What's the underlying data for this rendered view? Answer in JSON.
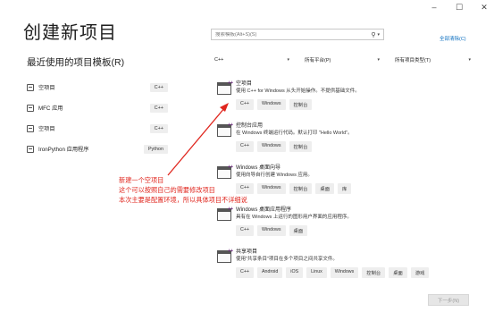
{
  "window": {
    "minimize": "–",
    "maximize": "☐",
    "close": "✕"
  },
  "page_title": "创建新项目",
  "recent": {
    "title": "最近使用的项目模板(R)",
    "items": [
      {
        "name": "空项目",
        "lang": "C++"
      },
      {
        "name": "MFC 应用",
        "lang": "C++"
      },
      {
        "name": "空项目",
        "lang": "C++"
      },
      {
        "name": "IronPython 应用程序",
        "lang": "Python"
      }
    ]
  },
  "search": {
    "placeholder": "搜索模板(Alt+S)(S)",
    "icon": "search-icon"
  },
  "clear_all": "全部清除(C)",
  "filters": {
    "language": "C++",
    "platform": "所有平台(P)",
    "project_type": "所有项目类型(T)"
  },
  "templates": [
    {
      "name": "空项目",
      "desc": "使用 C++ for Windows 从头开始操作。不提供基础文件。",
      "tags": [
        "C++",
        "Windows",
        "控制台"
      ]
    },
    {
      "name": "控制台应用",
      "desc": "在 Windows 终端运行代码。默认打印 \"Hello World\"。",
      "tags": [
        "C++",
        "Windows",
        "控制台"
      ]
    },
    {
      "name": "Windows 桌面向导",
      "desc": "使用向导自行创建 Windows 应用。",
      "tags": [
        "C++",
        "Windows",
        "控制台",
        "桌面",
        "库"
      ]
    },
    {
      "name": "Windows 桌面应用程序",
      "desc": "具有在 Windows 上运行的图形用户界面的应用程序。",
      "tags": [
        "C++",
        "Windows",
        "桌面"
      ]
    },
    {
      "name": "共享项目",
      "desc": "使用\"共享条目\"项目在多个项目之间共享文件。",
      "tags": [
        "C++",
        "Android",
        "iOS",
        "Linux",
        "Windows",
        "控制台",
        "桌面",
        "游戏"
      ]
    }
  ],
  "annotation": {
    "lines": [
      "新建一个空项目",
      "这个可以按照自己的需要修改项目",
      "本次主要是配置环境，所以具体项目不详细说"
    ],
    "color": "#e0261e"
  },
  "next_button": "下一步(N)"
}
